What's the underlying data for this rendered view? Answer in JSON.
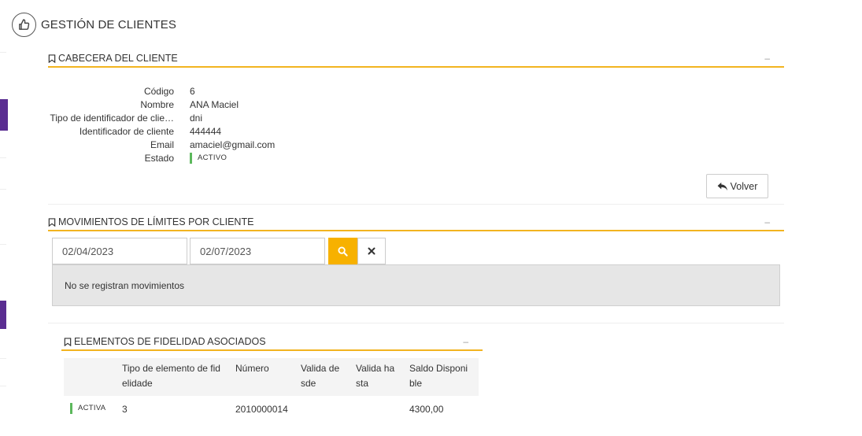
{
  "page": {
    "title": "GESTIÓN DE CLIENTES"
  },
  "colors": {
    "accent": "#f2b420",
    "rail": "#5a2d91",
    "status_active": "#5cb85c",
    "search_button": "#f7b100"
  },
  "header_section": {
    "title": "CABECERA DEL CLIENTE",
    "collapse_label": "–",
    "fields": [
      {
        "label": "Código",
        "value": "6"
      },
      {
        "label": "Nombre",
        "value": "ANA Maciel"
      },
      {
        "label": "Tipo de identificador de clie…",
        "value": "dni"
      },
      {
        "label": "Identificador de cliente",
        "value": "444444"
      },
      {
        "label": "Email",
        "value": "amaciel@gmail.com"
      }
    ],
    "status": {
      "label": "Estado",
      "value": "ACTIVO"
    },
    "back_button": "Volver"
  },
  "movements_section": {
    "title": "MOVIMIENTOS DE LÍMITES POR CLIENTE",
    "collapse_label": "–",
    "date_from": "02/04/2023",
    "date_to": "02/07/2023",
    "empty_message": "No se registran movimientos"
  },
  "loyalty_section": {
    "title": "ELEMENTOS DE FIDELIDAD ASOCIADOS",
    "collapse_label": "–",
    "columns": [
      "",
      "Tipo de elemento de fid elidade",
      "Número",
      "Valida de sde",
      "Valida ha sta",
      "Saldo Disponi ble"
    ],
    "rows": [
      {
        "status": "ACTIVA",
        "type": "3",
        "number": "2010000014",
        "valid_from": "",
        "valid_to": "",
        "balance": "4300,00"
      }
    ]
  }
}
